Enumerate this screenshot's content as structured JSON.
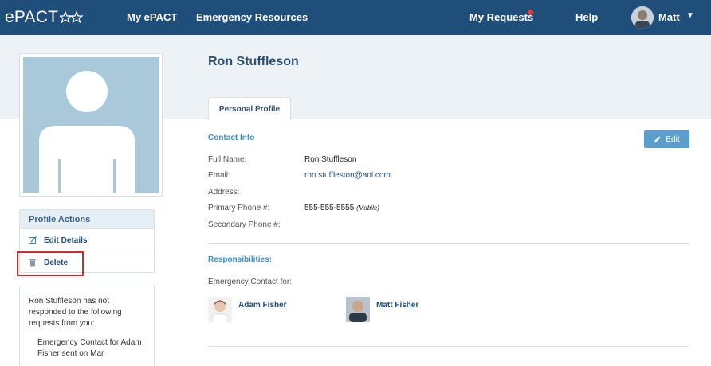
{
  "nav": {
    "logo": "ePACT",
    "links": [
      "My ePACT",
      "Emergency Resources"
    ],
    "my_requests": "My Requests",
    "help": "Help",
    "user": "Matt"
  },
  "profile": {
    "name": "Ron Stuffleson",
    "tab": "Personal Profile"
  },
  "actions": {
    "title": "Profile Actions",
    "edit": "Edit Details",
    "delete": "Delete"
  },
  "pending": {
    "text": "Ron Stuffleson has not responded to the following requests from you:",
    "item": "Emergency Contact for Adam Fisher sent on Mar"
  },
  "contact_info": {
    "title": "Contact Info",
    "edit_label": "Edit",
    "fields": [
      {
        "label": "Full Name:",
        "value": "Ron Stuffleson"
      },
      {
        "label": "Email:",
        "value": "ron.stuffleston@aol.com"
      },
      {
        "label": "Address:",
        "value": ""
      },
      {
        "label": "Primary Phone #:",
        "value": "555-555-5555",
        "note": "(Mobile)"
      },
      {
        "label": "Secondary Phone #:",
        "value": ""
      }
    ]
  },
  "responsibilities": {
    "title": "Responsibilities:",
    "subtitle": "Emergency Contact for:",
    "people": [
      "Adam Fisher",
      "Matt Fisher"
    ]
  },
  "colors": {
    "nav_bg": "#1f4e7a",
    "accent": "#3a8fd0",
    "edit_button": "#5b9ec9",
    "highlight": "#d62a2a"
  }
}
